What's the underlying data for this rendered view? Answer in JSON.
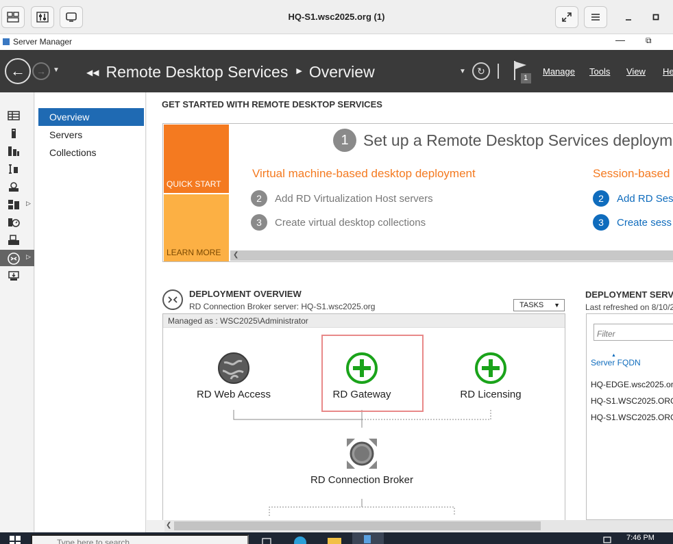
{
  "remote_client": {
    "title": "HQ-S1.wsc2025.org (1)"
  },
  "window": {
    "title": "Server Manager",
    "minimize_glyph": "—",
    "maximize_glyph": "⧉"
  },
  "header": {
    "breadcrumb_root": "Remote Desktop Services",
    "breadcrumb_current": "Overview",
    "notification_count": "1",
    "menu": [
      "Manage",
      "Tools",
      "View",
      "He"
    ]
  },
  "sidebar": {
    "items": [
      {
        "icon": "dashboard-icon"
      },
      {
        "icon": "local-server-icon"
      },
      {
        "icon": "all-servers-icon"
      },
      {
        "icon": "file-storage-icon"
      },
      {
        "icon": "iis-icon"
      },
      {
        "icon": "server-group-icon",
        "expandable": true
      },
      {
        "icon": "ipam-icon"
      },
      {
        "icon": "print-icon"
      },
      {
        "icon": "remote-desktop-icon",
        "expandable": true,
        "active": true
      },
      {
        "icon": "wsus-icon"
      }
    ]
  },
  "subnav": {
    "items": [
      "Overview",
      "Servers",
      "Collections"
    ],
    "active": "Overview"
  },
  "getting_started": {
    "title": "GET STARTED WITH REMOTE DESKTOP SERVICES",
    "quick_start": "QUICK START",
    "learn_more": "LEARN MORE",
    "step1_number": "1",
    "step1_text": "Set up a Remote Desktop Services deploym",
    "vm_section": {
      "heading": "Virtual machine-based desktop deployment",
      "steps": [
        {
          "number": "2",
          "text": "Add RD Virtualization Host servers"
        },
        {
          "number": "3",
          "text": "Create virtual desktop collections"
        }
      ]
    },
    "session_section": {
      "heading": "Session-based",
      "steps": [
        {
          "number": "2",
          "text": "Add RD Ses"
        },
        {
          "number": "3",
          "text": "Create sess"
        }
      ]
    }
  },
  "deployment_overview": {
    "title": "DEPLOYMENT OVERVIEW",
    "subtitle": "RD Connection Broker server: HQ-S1.wsc2025.org",
    "tasks_label": "TASKS",
    "managed_as": "Managed as : WSC2025\\Administrator",
    "roles": {
      "web_access": "RD Web Access",
      "gateway": "RD Gateway",
      "licensing": "RD Licensing",
      "broker": "RD Connection Broker"
    }
  },
  "deployment_servers": {
    "title": "DEPLOYMENT SERV",
    "subtitle": "Last refreshed on 8/10/2",
    "filter_placeholder": "Filter",
    "column": "Server FQDN",
    "servers": [
      "HQ-EDGE.wsc2025.org",
      "HQ-S1.WSC2025.ORG",
      "HQ-S1.WSC2025.ORG"
    ]
  },
  "taskbar": {
    "search_placeholder": "Type here to search",
    "time": "7:46 PM"
  },
  "colors": {
    "header_bg": "#3a3a3a",
    "accent_blue": "#1f6ab3",
    "quick_start_orange": "#f47a20",
    "learn_more_orange": "#fcb044",
    "plus_green": "#1aa31a"
  }
}
